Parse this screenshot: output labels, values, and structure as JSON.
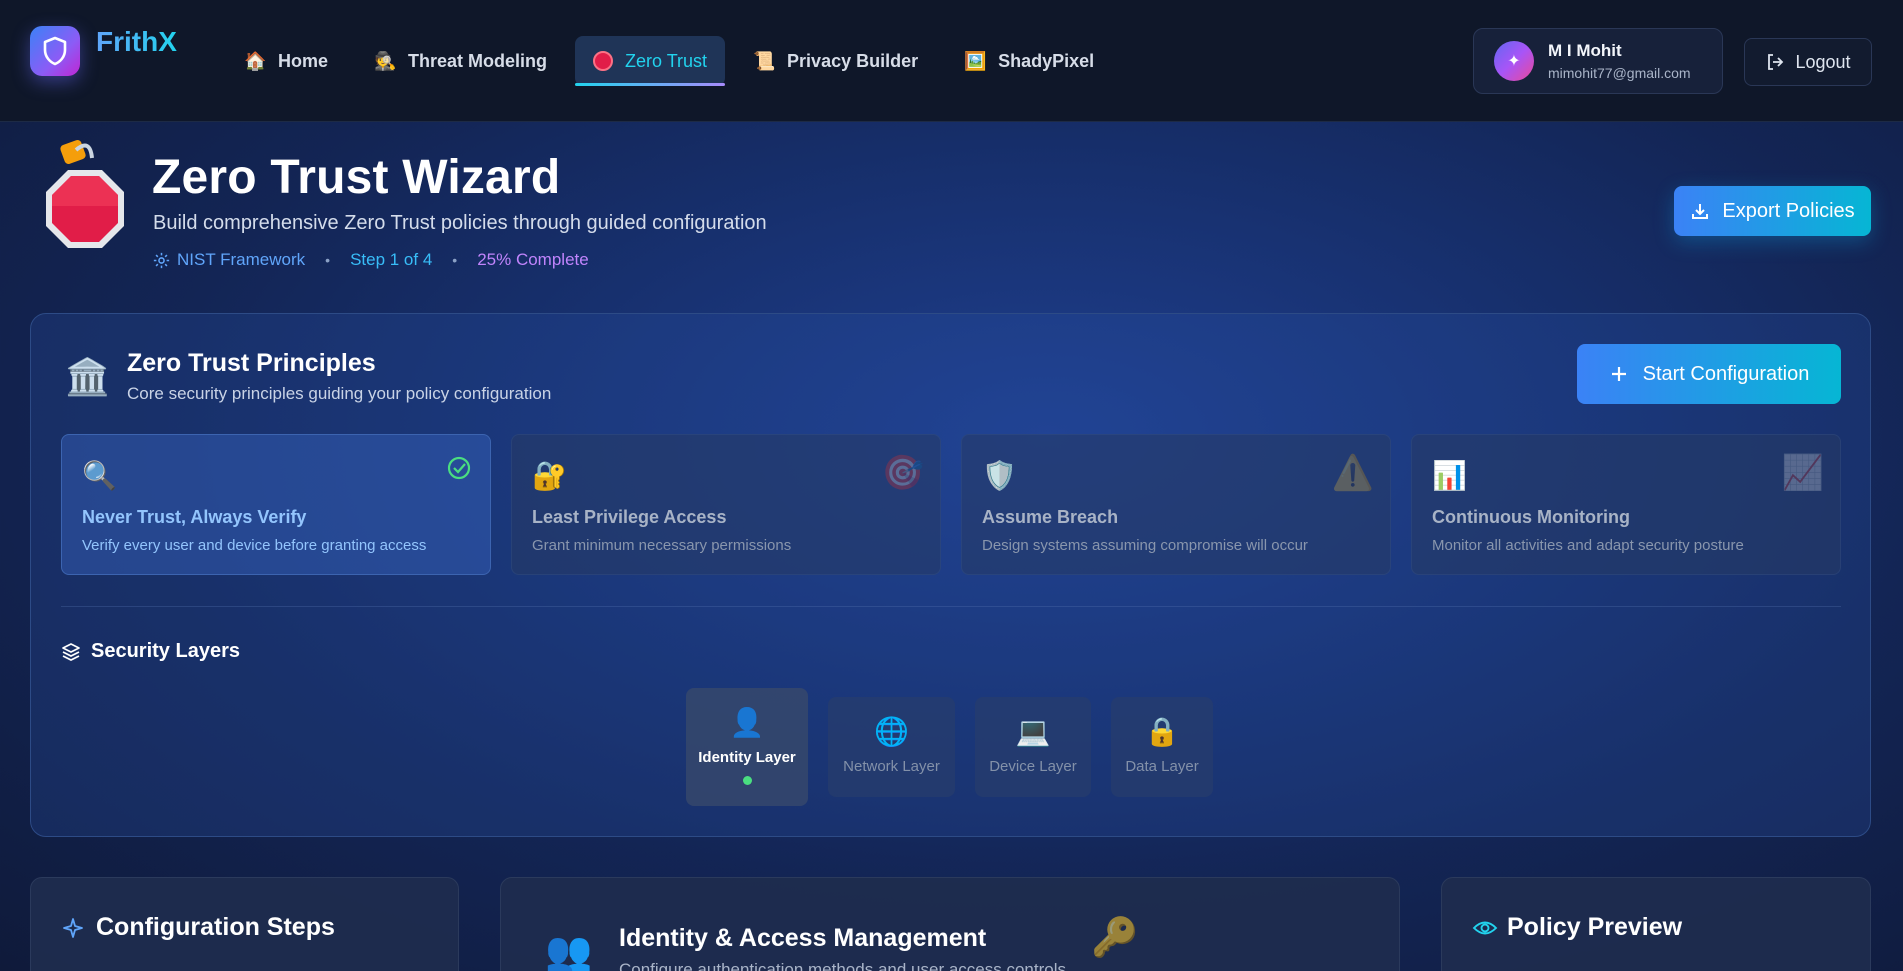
{
  "brand": {
    "name": "FrithX"
  },
  "nav": {
    "items": [
      {
        "label": "Home",
        "emoji": "🏠"
      },
      {
        "label": "Threat Modeling",
        "emoji": "🕵️"
      },
      {
        "label": "Zero Trust",
        "emoji": ""
      },
      {
        "label": "Privacy Builder",
        "emoji": "📜"
      },
      {
        "label": "ShadyPixel",
        "emoji": "🖼️"
      }
    ],
    "active_index": 2
  },
  "user": {
    "name": "M I Mohit",
    "email": "mimohit77@gmail.com",
    "avatar_initial": "✦",
    "logout_label": "Logout"
  },
  "header": {
    "title": "Zero Trust Wizard",
    "subtitle": "Build comprehensive Zero Trust policies through guided configuration",
    "framework": "NIST Framework",
    "step": "Step 1 of 4",
    "progress_text": "25% Complete",
    "export_label": "Export Policies"
  },
  "principles_panel": {
    "title": "Zero Trust Principles",
    "subtitle": "Core security principles guiding your policy configuration",
    "start_label": "Start Configuration",
    "items": [
      {
        "title": "Never Trust, Always Verify",
        "desc": "Verify every user and device before granting access",
        "icon": "🔍",
        "corner": "✅",
        "active": true
      },
      {
        "title": "Least Privilege Access",
        "desc": "Grant minimum necessary permissions",
        "icon": "🔐",
        "corner": "🎯",
        "active": false
      },
      {
        "title": "Assume Breach",
        "desc": "Design systems assuming compromise will occur",
        "icon": "🛡️",
        "corner": "⚠️",
        "active": false
      },
      {
        "title": "Continuous Monitoring",
        "desc": "Monitor all activities and adapt security posture",
        "icon": "📊",
        "corner": "📈",
        "active": false
      }
    ]
  },
  "layers": {
    "title": "Security Layers",
    "items": [
      {
        "label": "Identity Layer",
        "icon": "👤",
        "active": true
      },
      {
        "label": "Network Layer",
        "icon": "🌐",
        "active": false
      },
      {
        "label": "Device Layer",
        "icon": "💻",
        "active": false
      },
      {
        "label": "Data Layer",
        "icon": "🔒",
        "active": false
      }
    ]
  },
  "cards": {
    "steps_title": "Configuration Steps",
    "iam_title": "Identity & Access Management",
    "iam_subtitle": "Configure authentication methods and user access controls",
    "preview_title": "Policy Preview"
  },
  "colors": {
    "accent_blue": "#3b82f6",
    "accent_cyan": "#22d3ee",
    "accent_purple": "#c084fc",
    "active_green": "#4ade80",
    "nav_bg": "#0f1729"
  }
}
